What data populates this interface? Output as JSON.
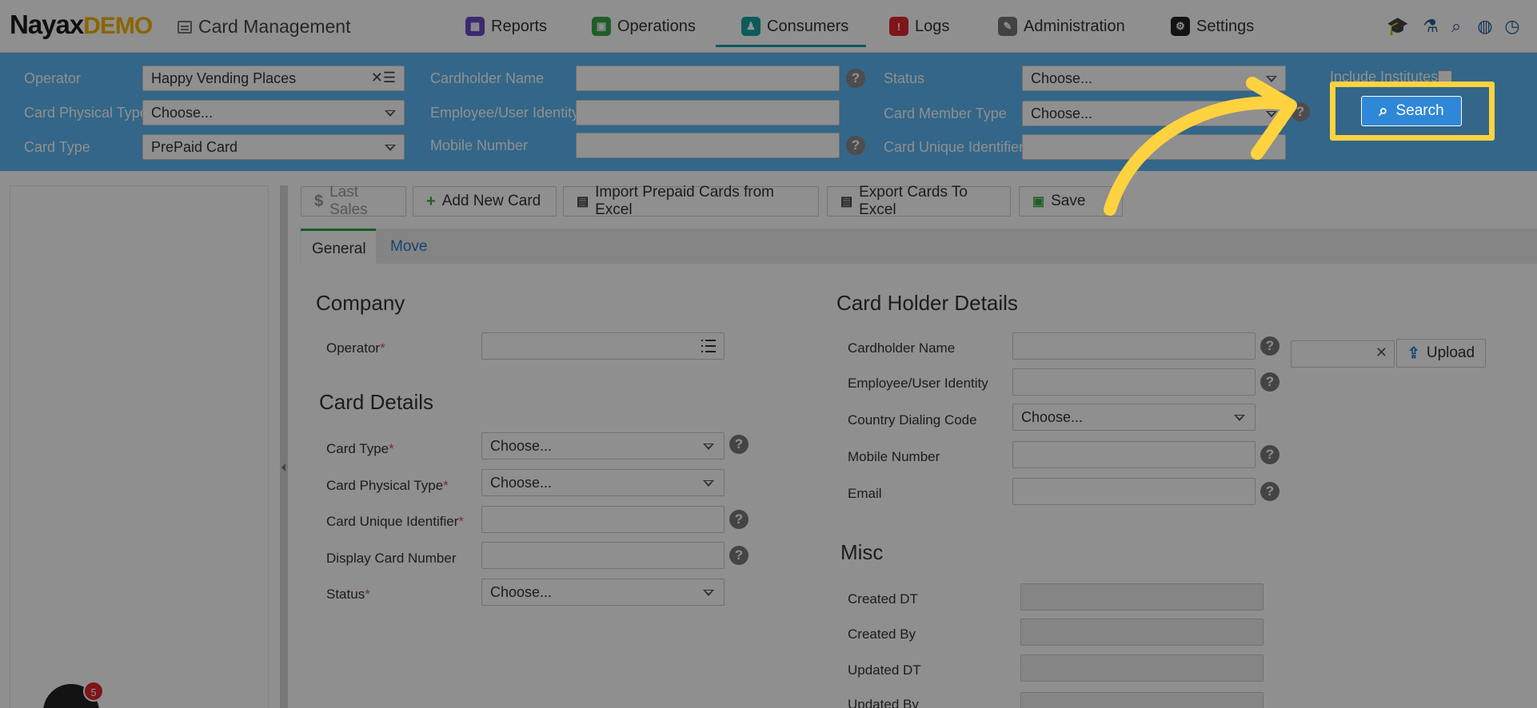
{
  "brand": {
    "name": "Nayax",
    "tag": "DEMO"
  },
  "page_title": "Card Management",
  "nav": [
    {
      "label": "Reports",
      "icon": "reports-icon",
      "color": "#6a4ac4"
    },
    {
      "label": "Operations",
      "icon": "operations-icon",
      "color": "#3aa84a"
    },
    {
      "label": "Consumers",
      "icon": "consumers-icon",
      "color": "#1aa3a3"
    },
    {
      "label": "Logs",
      "icon": "logs-icon",
      "color": "#e0262b"
    },
    {
      "label": "Administration",
      "icon": "administration-icon",
      "color": "#777777"
    },
    {
      "label": "Settings",
      "icon": "settings-icon",
      "color": "#222222"
    }
  ],
  "filters": {
    "operator_label": "Operator",
    "operator_value": "Happy Vending Places",
    "card_physical_type_label": "Card Physical Type",
    "card_physical_type_value": "Choose...",
    "card_type_label": "Card Type",
    "card_type_value": "PrePaid Card",
    "cardholder_name_label": "Cardholder Name",
    "employee_identity_label": "Employee/User Identity",
    "mobile_number_label": "Mobile Number",
    "status_label": "Status",
    "status_value": "Choose...",
    "card_member_type_label": "Card Member Type",
    "card_member_type_value": "Choose...",
    "card_unique_identifier_label": "Card Unique Identifier",
    "include_institutes_label": "Include Institutes",
    "search_label": "Search"
  },
  "toolbar": {
    "last_sales": "Last Sales",
    "add_new_card": "Add New Card",
    "import_prepaid": "Import Prepaid Cards from Excel",
    "export_cards": "Export Cards To Excel",
    "save": "Save"
  },
  "tabs": {
    "general": "General",
    "move": "Move"
  },
  "company": {
    "title": "Company",
    "operator_label": "Operator"
  },
  "card_details": {
    "title": "Card Details",
    "card_type_label": "Card Type",
    "card_type_value": "Choose...",
    "card_physical_type_label": "Card Physical Type",
    "card_physical_type_value": "Choose...",
    "card_unique_identifier_label": "Card Unique Identifier",
    "display_card_number_label": "Display Card Number",
    "status_label": "Status",
    "status_value": "Choose..."
  },
  "card_holder": {
    "title": "Card Holder Details",
    "cardholder_name_label": "Cardholder Name",
    "employee_identity_label": "Employee/User Identity",
    "country_dialing_code_label": "Country Dialing Code",
    "country_dialing_code_value": "Choose...",
    "mobile_number_label": "Mobile Number",
    "email_label": "Email",
    "upload_label": "Upload"
  },
  "misc": {
    "title": "Misc",
    "created_dt_label": "Created DT",
    "created_by_label": "Created By",
    "updated_dt_label": "Updated DT",
    "updated_by_label": "Updated By"
  },
  "notification_count": "5",
  "colors": {
    "filter_bar": "#5bb7f3",
    "accent": "#2f87d7",
    "highlight": "#ffd23f"
  }
}
